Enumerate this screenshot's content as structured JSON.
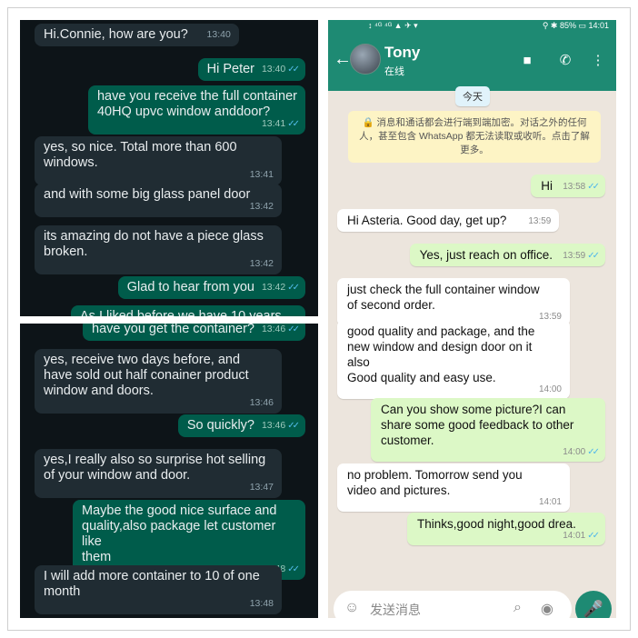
{
  "top_panel": {
    "messages": [
      {
        "dir": "in",
        "text": "Hi.Connie, how are you?",
        "time": "13:40"
      },
      {
        "dir": "out",
        "text": "Hi Peter",
        "time": "13:40",
        "tick": "✓✓"
      },
      {
        "dir": "out",
        "text": "have you receive the full container\n40HQ upvc window anddoor?",
        "time": "13:41",
        "tick": "✓✓"
      },
      {
        "dir": "in",
        "text": "yes, so nice. Total more than 600\nwindows.",
        "time": "13:41"
      },
      {
        "dir": "in",
        "text": "and with some big glass panel door",
        "time": "13:42"
      },
      {
        "dir": "in",
        "text": "its amazing do not have a piece glass\nbroken.",
        "time": "13:42"
      },
      {
        "dir": "out",
        "text": "Glad to hear from you",
        "time": "13:42",
        "tick": "✓✓"
      },
      {
        "dir": "out",
        "text": "As I liked before we have 10 years",
        "time": "",
        "tick": ""
      }
    ]
  },
  "bottom_panel": {
    "messages": [
      {
        "dir": "out",
        "text": "have you get the container?",
        "time": "13:46",
        "tick": "✓✓"
      },
      {
        "dir": "in",
        "text": "yes, receive two days before, and\nhave sold out half conainer product\nwindow and doors.",
        "time": "13:46"
      },
      {
        "dir": "out",
        "text": "So quickly?",
        "time": "13:46",
        "tick": "✓✓"
      },
      {
        "dir": "in",
        "text": "yes,I really also so surprise hot selling\nof your window and door.",
        "time": "13:47"
      },
      {
        "dir": "out",
        "text": "Maybe the good nice surface and\nquality,also package let customer like\nthem",
        "time": "13:48",
        "tick": "✓✓"
      },
      {
        "dir": "in",
        "text": "I will add more container to 10 of one\nmonth",
        "time": "13:48"
      }
    ]
  },
  "whatsapp": {
    "status_bar": {
      "left": "↕ ⁴ᴳ ⁴ᴳ ▲ ✈ ▾",
      "right": "⚲ ✱ 85% ▭ 14:01"
    },
    "contact_name": "Tony",
    "contact_status": "在线",
    "date_chip": "今天",
    "encryption_notice": "🔒 消息和通话都会进行端到端加密。对话之外的任何人，甚至包含 WhatsApp 都无法读取或收听。点击了解更多。",
    "messages": [
      {
        "dir": "out",
        "text": "Hi",
        "time": "13:58",
        "tick": "✓✓"
      },
      {
        "dir": "in",
        "text": "Hi Asteria. Good day, get up?",
        "time": "13:59"
      },
      {
        "dir": "out",
        "text": "Yes, just reach on office.",
        "time": "13:59",
        "tick": "✓✓"
      },
      {
        "dir": "in",
        "text": "just check the full container window\nof second order.",
        "time": "13:59"
      },
      {
        "dir": "in",
        "text": "good quality and package, and the\nnew window and design door on it\nalso\nGood quality and easy use.",
        "time": "14:00"
      },
      {
        "dir": "out",
        "text": "Can you show some picture?I can\nshare some  good feedback to other\ncustomer.",
        "time": "14:00",
        "tick": "✓✓"
      },
      {
        "dir": "in",
        "text": "no problem. Tomorrow send you\nvideo and pictures.",
        "time": "14:01"
      },
      {
        "dir": "out",
        "text": "Thinks,good night,good drea.",
        "time": "14:01",
        "tick": "✓✓"
      }
    ],
    "input_placeholder": "发送消息",
    "icons": {
      "back": "←",
      "video": "■",
      "call": "✆",
      "menu": "⋮",
      "emoji": "☺",
      "attach": "⌕",
      "camera": "◉",
      "mic": "🎤"
    }
  }
}
